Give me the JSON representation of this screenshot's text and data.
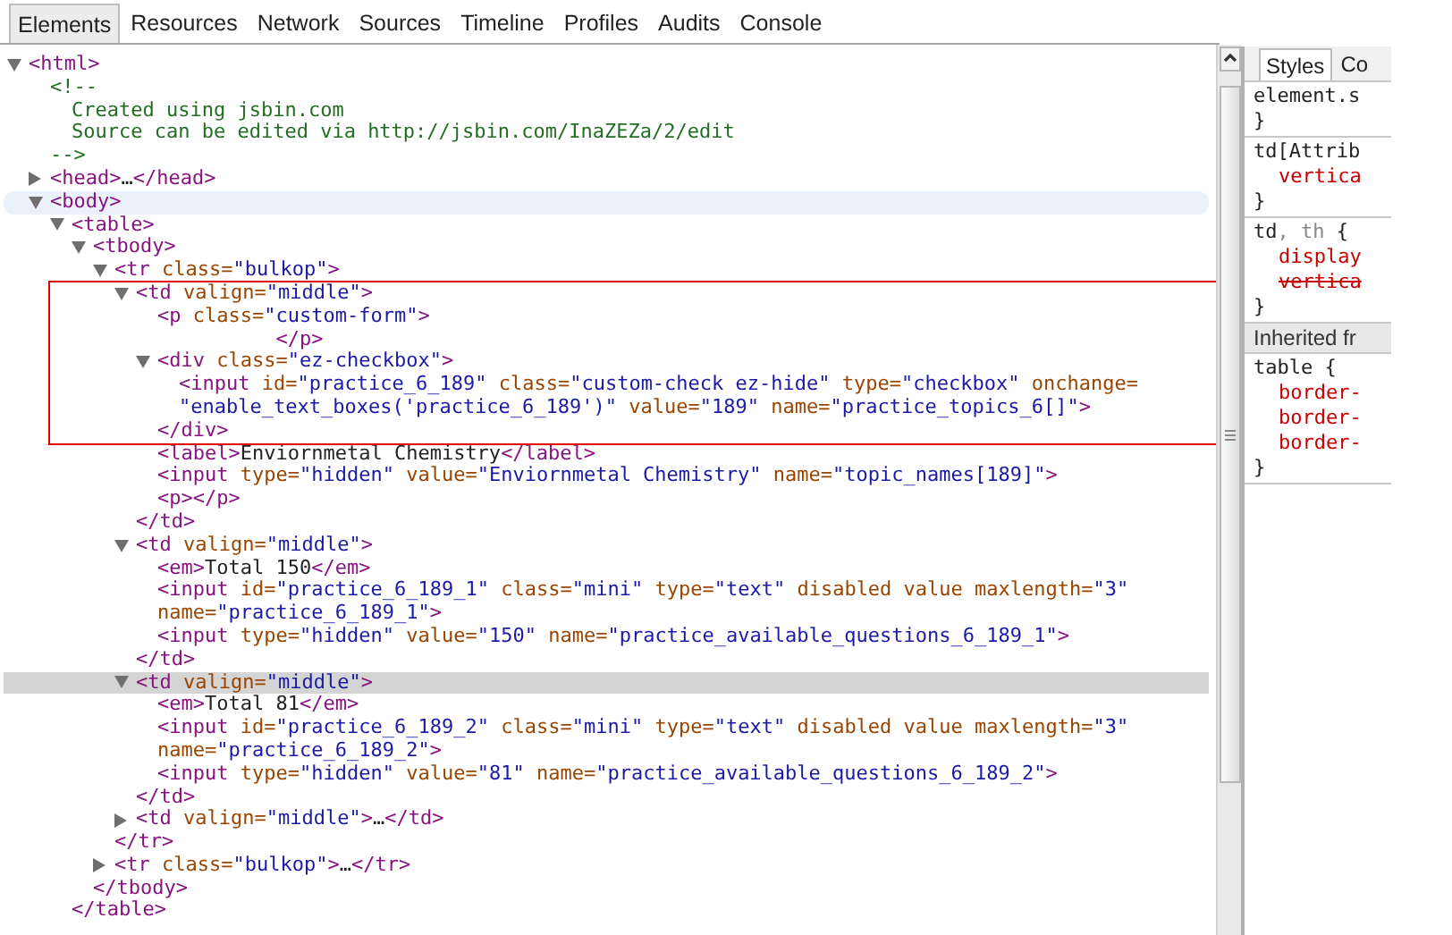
{
  "tabs": [
    {
      "label": "Elements",
      "selected": true
    },
    {
      "label": "Resources",
      "selected": false
    },
    {
      "label": "Network",
      "selected": false
    },
    {
      "label": "Sources",
      "selected": false
    },
    {
      "label": "Timeline",
      "selected": false
    },
    {
      "label": "Profiles",
      "selected": false
    },
    {
      "label": "Audits",
      "selected": false
    },
    {
      "label": "Console",
      "selected": false
    }
  ],
  "tree": [
    {
      "kind": "element",
      "expanded": true,
      "selected": false,
      "hovered": false,
      "boxed": false,
      "lines": [
        [
          {
            "kind": "tag",
            "text": "<html>"
          }
        ]
      ],
      "children": [
        {
          "kind": "comment",
          "selected": false,
          "hovered": false,
          "boxed": false,
          "lines": [
            [
              {
                "kind": "comment",
                "text": "<!--"
              }
            ]
          ],
          "children": [
            {
              "kind": "leaf",
              "selected": false,
              "hovered": false,
              "boxed": false,
              "lines": [
                [
                  {
                    "kind": "comment",
                    "text": "Created using jsbin.com"
                  }
                ]
              ]
            },
            {
              "kind": "leaf",
              "selected": false,
              "hovered": false,
              "boxed": false,
              "lines": [
                [
                  {
                    "kind": "comment",
                    "text": "Source can be edited via http://jsbin.com/InaZEZa/2/edit"
                  }
                ]
              ]
            }
          ],
          "close": {
            "tokens": [
              {
                "kind": "comment",
                "text": "-->"
              }
            ],
            "boxed": false
          }
        },
        {
          "kind": "element",
          "expanded": false,
          "selected": false,
          "hovered": false,
          "boxed": false,
          "lines": [
            [
              {
                "kind": "tag",
                "text": "<head>"
              },
              {
                "kind": "text",
                "text": "…"
              },
              {
                "kind": "tag",
                "text": "</head>"
              }
            ]
          ]
        },
        {
          "kind": "element",
          "expanded": true,
          "selected": false,
          "hovered": true,
          "boxed": false,
          "lines": [
            [
              {
                "kind": "tag",
                "text": "<body>"
              }
            ]
          ],
          "children": [
            {
              "kind": "element",
              "expanded": true,
              "selected": false,
              "hovered": false,
              "boxed": false,
              "lines": [
                [
                  {
                    "kind": "tag",
                    "text": "<table>"
                  }
                ]
              ],
              "children": [
                {
                  "kind": "element",
                  "expanded": true,
                  "selected": false,
                  "hovered": false,
                  "boxed": false,
                  "lines": [
                    [
                      {
                        "kind": "tag",
                        "text": "<tbody>"
                      }
                    ]
                  ],
                  "children": [
                    {
                      "kind": "element",
                      "expanded": true,
                      "selected": false,
                      "hovered": false,
                      "boxed": false,
                      "lines": [
                        [
                          {
                            "kind": "tag",
                            "text": "<tr"
                          },
                          {
                            "kind": "attr",
                            "text": " class="
                          },
                          {
                            "kind": "value",
                            "text": "\"bulkop\""
                          },
                          {
                            "kind": "tag",
                            "text": ">"
                          }
                        ]
                      ],
                      "children": [
                        {
                          "kind": "element",
                          "expanded": true,
                          "selected": false,
                          "hovered": false,
                          "boxed": true,
                          "lines": [
                            [
                              {
                                "kind": "tag",
                                "text": "<td"
                              },
                              {
                                "kind": "attr",
                                "text": " valign="
                              },
                              {
                                "kind": "value",
                                "text": "\"middle\""
                              },
                              {
                                "kind": "tag",
                                "text": ">"
                              }
                            ]
                          ],
                          "children": [
                            {
                              "kind": "leaf",
                              "selected": false,
                              "hovered": false,
                              "boxed": true,
                              "lines": [
                                [
                                  {
                                    "kind": "tag",
                                    "text": "<p"
                                  },
                                  {
                                    "kind": "attr",
                                    "text": " class="
                                  },
                                  {
                                    "kind": "value",
                                    "text": "\"custom-form\""
                                  },
                                  {
                                    "kind": "tag",
                                    "text": ">"
                                  }
                                ],
                                [
                                  {
                                    "kind": "tag",
                                    "text": "          </p>"
                                  }
                                ]
                              ]
                            },
                            {
                              "kind": "element",
                              "expanded": true,
                              "selected": false,
                              "hovered": false,
                              "boxed": true,
                              "lines": [
                                [
                                  {
                                    "kind": "tag",
                                    "text": "<div"
                                  },
                                  {
                                    "kind": "attr",
                                    "text": " class="
                                  },
                                  {
                                    "kind": "value",
                                    "text": "\"ez-checkbox\""
                                  },
                                  {
                                    "kind": "tag",
                                    "text": ">"
                                  }
                                ]
                              ],
                              "children": [
                                {
                                  "kind": "leaf",
                                  "selected": false,
                                  "hovered": false,
                                  "boxed": true,
                                  "lines": [
                                    [
                                      {
                                        "kind": "tag",
                                        "text": "<input"
                                      },
                                      {
                                        "kind": "attr",
                                        "text": " id="
                                      },
                                      {
                                        "kind": "value",
                                        "text": "\"practice_6_189\""
                                      },
                                      {
                                        "kind": "attr",
                                        "text": " class="
                                      },
                                      {
                                        "kind": "value",
                                        "text": "\"custom-check ez-hide\""
                                      },
                                      {
                                        "kind": "attr",
                                        "text": " type="
                                      },
                                      {
                                        "kind": "value",
                                        "text": "\"checkbox\""
                                      },
                                      {
                                        "kind": "attr",
                                        "text": " onchange="
                                      }
                                    ],
                                    [
                                      {
                                        "kind": "value",
                                        "text": "\"enable_text_boxes('practice_6_189')\""
                                      },
                                      {
                                        "kind": "attr",
                                        "text": " value="
                                      },
                                      {
                                        "kind": "value",
                                        "text": "\"189\""
                                      },
                                      {
                                        "kind": "attr",
                                        "text": " name="
                                      },
                                      {
                                        "kind": "value",
                                        "text": "\"practice_topics_6[]\""
                                      },
                                      {
                                        "kind": "tag",
                                        "text": ">"
                                      }
                                    ]
                                  ]
                                }
                              ],
                              "close": {
                                "tokens": [
                                  {
                                    "kind": "tag",
                                    "text": "</div>"
                                  }
                                ],
                                "boxed": true
                              }
                            },
                            {
                              "kind": "leaf",
                              "selected": false,
                              "hovered": false,
                              "boxed": false,
                              "lines": [
                                [
                                  {
                                    "kind": "tag",
                                    "text": "<label>"
                                  },
                                  {
                                    "kind": "text",
                                    "text": "Enviornmetal Chemistry"
                                  },
                                  {
                                    "kind": "tag",
                                    "text": "</label>"
                                  }
                                ]
                              ]
                            },
                            {
                              "kind": "leaf",
                              "selected": false,
                              "hovered": false,
                              "boxed": false,
                              "lines": [
                                [
                                  {
                                    "kind": "tag",
                                    "text": "<input"
                                  },
                                  {
                                    "kind": "attr",
                                    "text": " type="
                                  },
                                  {
                                    "kind": "value",
                                    "text": "\"hidden\""
                                  },
                                  {
                                    "kind": "attr",
                                    "text": " value="
                                  },
                                  {
                                    "kind": "value",
                                    "text": "\"Enviornmetal Chemistry\""
                                  },
                                  {
                                    "kind": "attr",
                                    "text": " name="
                                  },
                                  {
                                    "kind": "value",
                                    "text": "\"topic_names[189]\""
                                  },
                                  {
                                    "kind": "tag",
                                    "text": ">"
                                  }
                                ]
                              ]
                            },
                            {
                              "kind": "leaf",
                              "selected": false,
                              "hovered": false,
                              "boxed": false,
                              "lines": [
                                [
                                  {
                                    "kind": "tag",
                                    "text": "<p></p>"
                                  }
                                ]
                              ]
                            }
                          ],
                          "close": {
                            "tokens": [
                              {
                                "kind": "tag",
                                "text": "</td>"
                              }
                            ],
                            "boxed": false
                          }
                        },
                        {
                          "kind": "element",
                          "expanded": true,
                          "selected": false,
                          "hovered": false,
                          "boxed": false,
                          "lines": [
                            [
                              {
                                "kind": "tag",
                                "text": "<td"
                              },
                              {
                                "kind": "attr",
                                "text": " valign="
                              },
                              {
                                "kind": "value",
                                "text": "\"middle\""
                              },
                              {
                                "kind": "tag",
                                "text": ">"
                              }
                            ]
                          ],
                          "children": [
                            {
                              "kind": "leaf",
                              "selected": false,
                              "hovered": false,
                              "boxed": false,
                              "lines": [
                                [
                                  {
                                    "kind": "tag",
                                    "text": "<em>"
                                  },
                                  {
                                    "kind": "text",
                                    "text": "Total 150"
                                  },
                                  {
                                    "kind": "tag",
                                    "text": "</em>"
                                  }
                                ]
                              ]
                            },
                            {
                              "kind": "leaf",
                              "selected": false,
                              "hovered": false,
                              "boxed": false,
                              "lines": [
                                [
                                  {
                                    "kind": "tag",
                                    "text": "<input"
                                  },
                                  {
                                    "kind": "attr",
                                    "text": " id="
                                  },
                                  {
                                    "kind": "value",
                                    "text": "\"practice_6_189_1\""
                                  },
                                  {
                                    "kind": "attr",
                                    "text": " class="
                                  },
                                  {
                                    "kind": "value",
                                    "text": "\"mini\""
                                  },
                                  {
                                    "kind": "attr",
                                    "text": " type="
                                  },
                                  {
                                    "kind": "value",
                                    "text": "\"text\""
                                  },
                                  {
                                    "kind": "attr",
                                    "text": " disabled value maxlength="
                                  },
                                  {
                                    "kind": "value",
                                    "text": "\"3\""
                                  }
                                ],
                                [
                                  {
                                    "kind": "attr",
                                    "text": "name="
                                  },
                                  {
                                    "kind": "value",
                                    "text": "\"practice_6_189_1\""
                                  },
                                  {
                                    "kind": "tag",
                                    "text": ">"
                                  }
                                ]
                              ]
                            },
                            {
                              "kind": "leaf",
                              "selected": false,
                              "hovered": false,
                              "boxed": false,
                              "lines": [
                                [
                                  {
                                    "kind": "tag",
                                    "text": "<input"
                                  },
                                  {
                                    "kind": "attr",
                                    "text": " type="
                                  },
                                  {
                                    "kind": "value",
                                    "text": "\"hidden\""
                                  },
                                  {
                                    "kind": "attr",
                                    "text": " value="
                                  },
                                  {
                                    "kind": "value",
                                    "text": "\"150\""
                                  },
                                  {
                                    "kind": "attr",
                                    "text": " name="
                                  },
                                  {
                                    "kind": "value",
                                    "text": "\"practice_available_questions_6_189_1\""
                                  },
                                  {
                                    "kind": "tag",
                                    "text": ">"
                                  }
                                ]
                              ]
                            }
                          ],
                          "close": {
                            "tokens": [
                              {
                                "kind": "tag",
                                "text": "</td>"
                              }
                            ],
                            "boxed": false
                          }
                        },
                        {
                          "kind": "element",
                          "expanded": true,
                          "selected": true,
                          "hovered": false,
                          "boxed": false,
                          "lines": [
                            [
                              {
                                "kind": "tag",
                                "text": "<td"
                              },
                              {
                                "kind": "attr",
                                "text": " valign="
                              },
                              {
                                "kind": "value",
                                "text": "\"middle\""
                              },
                              {
                                "kind": "tag",
                                "text": ">"
                              }
                            ]
                          ],
                          "children": [
                            {
                              "kind": "leaf",
                              "selected": false,
                              "hovered": false,
                              "boxed": false,
                              "lines": [
                                [
                                  {
                                    "kind": "tag",
                                    "text": "<em>"
                                  },
                                  {
                                    "kind": "text",
                                    "text": "Total 81"
                                  },
                                  {
                                    "kind": "tag",
                                    "text": "</em>"
                                  }
                                ]
                              ]
                            },
                            {
                              "kind": "leaf",
                              "selected": false,
                              "hovered": false,
                              "boxed": false,
                              "lines": [
                                [
                                  {
                                    "kind": "tag",
                                    "text": "<input"
                                  },
                                  {
                                    "kind": "attr",
                                    "text": " id="
                                  },
                                  {
                                    "kind": "value",
                                    "text": "\"practice_6_189_2\""
                                  },
                                  {
                                    "kind": "attr",
                                    "text": " class="
                                  },
                                  {
                                    "kind": "value",
                                    "text": "\"mini\""
                                  },
                                  {
                                    "kind": "attr",
                                    "text": " type="
                                  },
                                  {
                                    "kind": "value",
                                    "text": "\"text\""
                                  },
                                  {
                                    "kind": "attr",
                                    "text": " disabled value maxlength="
                                  },
                                  {
                                    "kind": "value",
                                    "text": "\"3\""
                                  }
                                ],
                                [
                                  {
                                    "kind": "attr",
                                    "text": "name="
                                  },
                                  {
                                    "kind": "value",
                                    "text": "\"practice_6_189_2\""
                                  },
                                  {
                                    "kind": "tag",
                                    "text": ">"
                                  }
                                ]
                              ]
                            },
                            {
                              "kind": "leaf",
                              "selected": false,
                              "hovered": false,
                              "boxed": false,
                              "lines": [
                                [
                                  {
                                    "kind": "tag",
                                    "text": "<input"
                                  },
                                  {
                                    "kind": "attr",
                                    "text": " type="
                                  },
                                  {
                                    "kind": "value",
                                    "text": "\"hidden\""
                                  },
                                  {
                                    "kind": "attr",
                                    "text": " value="
                                  },
                                  {
                                    "kind": "value",
                                    "text": "\"81\""
                                  },
                                  {
                                    "kind": "attr",
                                    "text": " name="
                                  },
                                  {
                                    "kind": "value",
                                    "text": "\"practice_available_questions_6_189_2\""
                                  },
                                  {
                                    "kind": "tag",
                                    "text": ">"
                                  }
                                ]
                              ]
                            }
                          ],
                          "close": {
                            "tokens": [
                              {
                                "kind": "tag",
                                "text": "</td>"
                              }
                            ],
                            "boxed": false
                          }
                        },
                        {
                          "kind": "element",
                          "expanded": false,
                          "selected": false,
                          "hovered": false,
                          "boxed": false,
                          "lines": [
                            [
                              {
                                "kind": "tag",
                                "text": "<td"
                              },
                              {
                                "kind": "attr",
                                "text": " valign="
                              },
                              {
                                "kind": "value",
                                "text": "\"middle\""
                              },
                              {
                                "kind": "tag",
                                "text": ">"
                              },
                              {
                                "kind": "text",
                                "text": "…"
                              },
                              {
                                "kind": "tag",
                                "text": "</td>"
                              }
                            ]
                          ]
                        }
                      ],
                      "close": {
                        "tokens": [
                          {
                            "kind": "tag",
                            "text": "</tr>"
                          }
                        ],
                        "boxed": false
                      }
                    },
                    {
                      "kind": "element",
                      "expanded": false,
                      "selected": false,
                      "hovered": false,
                      "boxed": false,
                      "lines": [
                        [
                          {
                            "kind": "tag",
                            "text": "<tr"
                          },
                          {
                            "kind": "attr",
                            "text": " class="
                          },
                          {
                            "kind": "value",
                            "text": "\"bulkop\""
                          },
                          {
                            "kind": "tag",
                            "text": ">"
                          },
                          {
                            "kind": "text",
                            "text": "…"
                          },
                          {
                            "kind": "tag",
                            "text": "</tr>"
                          }
                        ]
                      ]
                    }
                  ],
                  "close": {
                    "tokens": [
                      {
                        "kind": "tag",
                        "text": "</tbody>"
                      }
                    ],
                    "boxed": false
                  }
                }
              ],
              "close": {
                "tokens": [
                  {
                    "kind": "tag",
                    "text": "</table>"
                  }
                ],
                "boxed": false
              }
            }
          ]
        }
      ]
    }
  ],
  "styles_panel": {
    "tabs": [
      {
        "label": "Styles",
        "selected": true
      },
      {
        "label": "Co",
        "selected": false
      }
    ],
    "sections": [
      {
        "kind": "rule",
        "selector": [
          {
            "kind": "sel",
            "text": "element.s"
          }
        ],
        "close": "}"
      },
      {
        "kind": "rule",
        "selector": [
          {
            "kind": "sel",
            "text": "td[Attrib"
          }
        ],
        "properties": [
          {
            "text": "vertica",
            "struck": false
          }
        ],
        "close": "}"
      },
      {
        "kind": "rule",
        "selector": [
          {
            "kind": "sel",
            "text": "td"
          },
          {
            "kind": "dim",
            "text": ", th"
          },
          {
            "kind": "sel",
            "text": " {"
          }
        ],
        "properties": [
          {
            "text": "display",
            "struck": false
          },
          {
            "text": "vertica",
            "struck": true
          }
        ],
        "close": "}"
      },
      {
        "kind": "header",
        "text": "Inherited fr"
      },
      {
        "kind": "rule",
        "selector": [
          {
            "kind": "sel",
            "text": "table {"
          }
        ],
        "properties": [
          {
            "text": "border-",
            "struck": false
          },
          {
            "text": "border-",
            "struck": false
          },
          {
            "text": "border-",
            "struck": false
          }
        ],
        "close": "}"
      }
    ]
  }
}
